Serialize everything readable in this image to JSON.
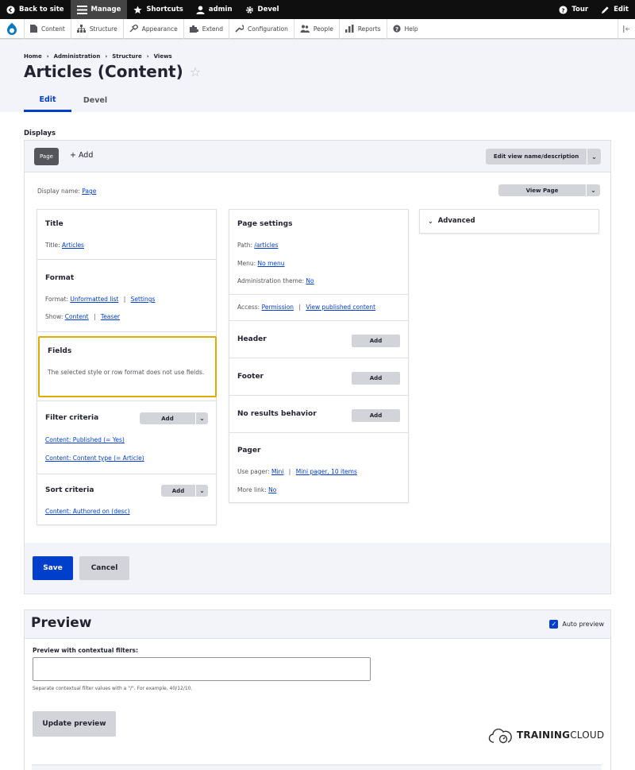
{
  "toolbar": {
    "back": "Back to site",
    "manage": "Manage",
    "shortcuts": "Shortcuts",
    "user": "admin",
    "devel": "Devel",
    "tour": "Tour",
    "edit": "Edit"
  },
  "tray": {
    "items": [
      "Content",
      "Structure",
      "Appearance",
      "Extend",
      "Configuration",
      "People",
      "Reports",
      "Help"
    ]
  },
  "breadcrumb": [
    "Home",
    "Administration",
    "Structure",
    "Views"
  ],
  "breadcrumb_sep": "›",
  "page_title": "Articles (Content)",
  "star": "☆",
  "tabs": [
    "Edit",
    "Devel"
  ],
  "displays_label": "Displays",
  "displays": {
    "current": "Page",
    "add": "+ Add",
    "edit_name_btn": "Edit view name/description",
    "display_name_label": "Display name:",
    "display_name_value": "Page",
    "view_page_btn": "View Page"
  },
  "col1": {
    "title": {
      "heading": "Title",
      "label": "Title:",
      "value": "Articles"
    },
    "format": {
      "heading": "Format",
      "format_label": "Format:",
      "format_value": "Unformatted list",
      "settings": "Settings",
      "show_label": "Show:",
      "show_value": "Content",
      "teaser": "Teaser"
    },
    "fields": {
      "heading": "Fields",
      "text": "The selected style or row format does not use fields."
    },
    "filter": {
      "heading": "Filter criteria",
      "add": "Add",
      "items": [
        "Content: Published (= Yes)",
        "Content: Content type (= Article)"
      ]
    },
    "sort": {
      "heading": "Sort criteria",
      "add": "Add",
      "items": [
        "Content: Authored on (desc)"
      ]
    }
  },
  "col2": {
    "page_settings": {
      "heading": "Page settings",
      "path_label": "Path:",
      "path_value": "/articles",
      "menu_label": "Menu:",
      "menu_value": "No menu",
      "admin_label": "Administration theme:",
      "admin_value": "No",
      "access_label": "Access:",
      "access_value": "Permission",
      "access_extra": "View published content"
    },
    "header": {
      "heading": "Header",
      "add": "Add"
    },
    "footer": {
      "heading": "Footer",
      "add": "Add"
    },
    "no_results": {
      "heading": "No results behavior",
      "add": "Add"
    },
    "pager": {
      "heading": "Pager",
      "use_label": "Use pager:",
      "use_value": "Mini",
      "use_extra": "Mini pager, 10 items",
      "more_label": "More link:",
      "more_value": "No"
    }
  },
  "col3": {
    "advanced": "Advanced"
  },
  "actions": {
    "save": "Save",
    "cancel": "Cancel"
  },
  "preview": {
    "title": "Preview",
    "auto": "Auto preview",
    "filters_label": "Preview with contextual filters:",
    "filters_value": "",
    "help": "Separate contextual filter values with a \"/\". For example, 40/12/10.",
    "update": "Update preview"
  },
  "brand": {
    "training": "TRAINING",
    "cloud": "CLOUD"
  }
}
